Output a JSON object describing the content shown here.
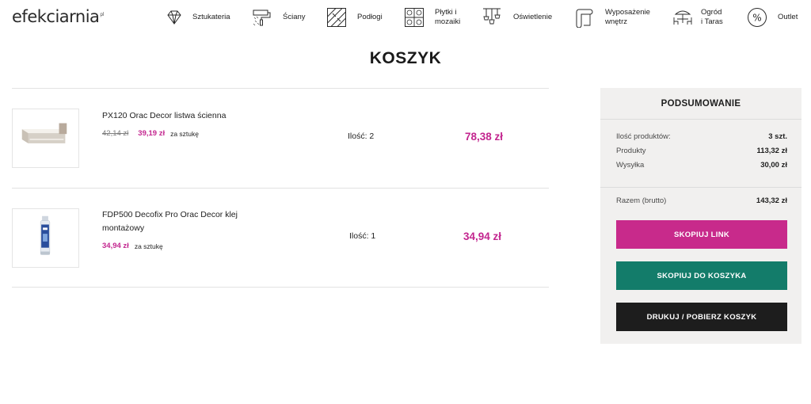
{
  "header": {
    "logo": "efekciarnia",
    "logo_suffix": "pl",
    "nav": [
      {
        "label": "Sztukateria",
        "icon": "diamond-icon"
      },
      {
        "label": "Ściany",
        "icon": "paint-roller-icon"
      },
      {
        "label": "Podłogi",
        "icon": "floor-planks-icon"
      },
      {
        "label": "Płytki i\nmozaiki",
        "icon": "tiles-icon"
      },
      {
        "label": "Oświetlenie",
        "icon": "pendant-lamp-icon"
      },
      {
        "label": "Wyposażenie\nwnętrz",
        "icon": "rolled-rug-icon"
      },
      {
        "label": "Ogród\ni Taras",
        "icon": "garden-table-icon"
      },
      {
        "label": "Outlet",
        "icon": "percent-icon"
      }
    ]
  },
  "page": {
    "title": "KOSZYK"
  },
  "cart": {
    "items": [
      {
        "name": "PX120 Orac Decor listwa ścienna",
        "price_old": "42,14 zł",
        "price": "39,19 zł",
        "per_unit": "za sztukę",
        "quantity": "Ilość: 2",
        "total": "78,38 zł"
      },
      {
        "name": "FDP500 Decofix Pro Orac Decor klej montażowy",
        "price": "34,94 zł",
        "per_unit": "za sztukę",
        "quantity": "Ilość: 1",
        "total": "34,94 zł"
      }
    ]
  },
  "summary": {
    "title": "PODSUMOWANIE",
    "products_count_label": "Ilość produktów:",
    "products_count_value": "3 szt.",
    "products_label": "Produkty",
    "products_value": "113,32 zł",
    "shipping_label": "Wysyłka",
    "shipping_value": "30,00 zł",
    "total_label": "Razem (brutto)",
    "total_value": "143,32 zł",
    "buttons": {
      "copy_link": "SKOPIUJ LINK",
      "copy_to_cart": "SKOPIUJ DO KOSZYKA",
      "print": "DRUKUJ / POBIERZ KOSZYK"
    }
  },
  "colors": {
    "accent_pink": "#c3268f",
    "teal": "#137c6a",
    "dark": "#1d1d1d",
    "summary_bg": "#f1f0ef"
  }
}
